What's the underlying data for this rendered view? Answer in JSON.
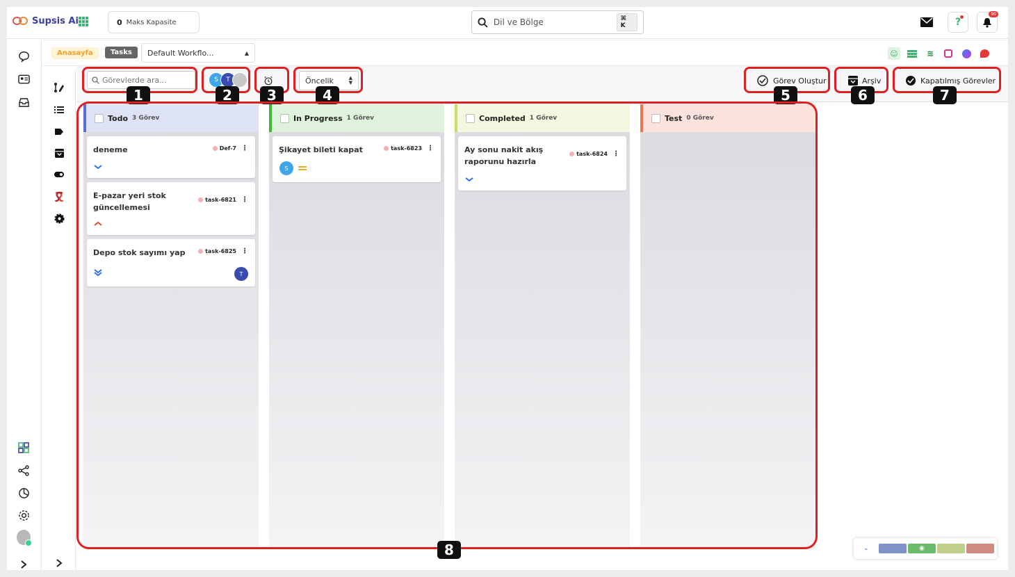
{
  "header": {
    "logo_text": "Supsis Ai",
    "capacity_value": "0",
    "capacity_label": "Maks Kapasite",
    "search_value": "Dil ve Bölge",
    "search_shortcut": "⌘ K",
    "notification_count": "90"
  },
  "subheader": {
    "breadcrumb_home": "Anasayfa",
    "breadcrumb_tasks": "Tasks",
    "workflow_selected": "Default Workflo..."
  },
  "toolbar": {
    "search_placeholder": "Görevlerde ara...",
    "avatars": [
      "S",
      "T",
      ""
    ],
    "priority_selected": "Öncelik",
    "create_task_label": "Görev Oluştur",
    "archive_label": "Arşiv",
    "closed_tasks_label": "Kapatılmış Görevler"
  },
  "columns": [
    {
      "title": "Todo",
      "count": "3 Görev",
      "color": "#5b6ed6",
      "cards": [
        {
          "title": "deneme",
          "id": "Def-7",
          "priority": "low"
        },
        {
          "title": "E-pazar yeri stok güncellemesi",
          "id": "task-6821",
          "priority": "high"
        },
        {
          "title": "Depo stok sayımı yap",
          "id": "task-6825",
          "priority": "lowest",
          "assignee": "T"
        }
      ]
    },
    {
      "title": "In Progress",
      "count": "1 Görev",
      "color": "#3cb92e",
      "cards": [
        {
          "title": "Şikayet bileti kapat",
          "id": "task-6823",
          "priority": "medium",
          "assignee": "S"
        }
      ]
    },
    {
      "title": "Completed",
      "count": "1 Görev",
      "color": "#c8de6a",
      "cards": [
        {
          "title": "Ay sonu nakit akış raporunu hazırla",
          "id": "task-6824",
          "priority": "low"
        }
      ]
    },
    {
      "title": "Test",
      "count": "0 Görev",
      "color": "#f0705a",
      "cards": []
    }
  ],
  "annotations": [
    "1",
    "2",
    "3",
    "4",
    "5",
    "6",
    "7",
    "8"
  ],
  "colors": {
    "accent": "#3b3f9c",
    "annotation_red": "#e02020",
    "avatar_s": "#3fa6ea",
    "avatar_t": "#3a4bb0"
  }
}
